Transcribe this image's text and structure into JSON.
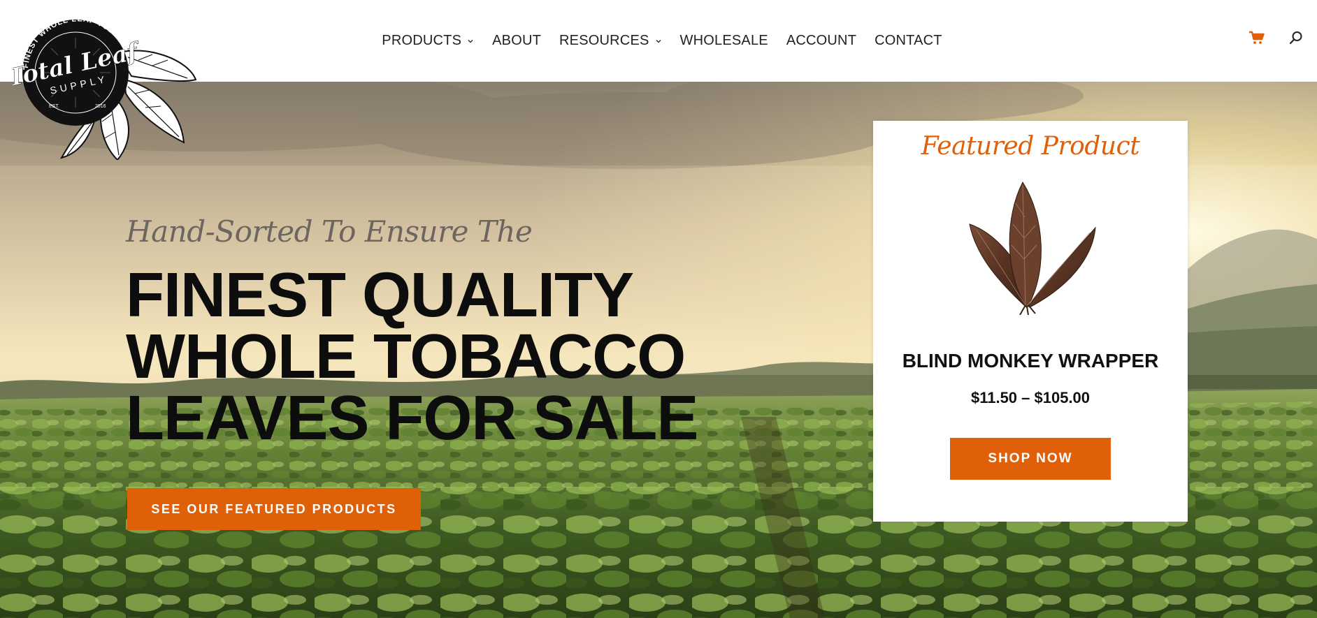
{
  "brand": {
    "logo_text": "Total Leaf",
    "logo_sub": "SUPPLY",
    "logo_ring": "FINEST WHOLE LEAF TOBACCO",
    "logo_est": "EST.",
    "logo_year": "2016"
  },
  "nav": {
    "items": [
      {
        "label": "PRODUCTS",
        "has_dropdown": true
      },
      {
        "label": "ABOUT",
        "has_dropdown": false
      },
      {
        "label": "RESOURCES",
        "has_dropdown": true
      },
      {
        "label": "WHOLESALE",
        "has_dropdown": false
      },
      {
        "label": "ACCOUNT",
        "has_dropdown": false
      },
      {
        "label": "CONTACT",
        "has_dropdown": false
      }
    ],
    "icons": [
      "cart-icon",
      "search-icon"
    ]
  },
  "hero": {
    "tagline": "Hand-Sorted To Ensure The",
    "headline_lines": [
      "FINEST QUALITY",
      "WHOLE TOBACCO",
      "LEAVES FOR SALE"
    ],
    "cta_label": "SEE OUR FEATURED PRODUCTS"
  },
  "featured": {
    "title": "Featured Product",
    "product_name": "BLIND MONKEY WRAPPER",
    "price": "$11.50 – $105.00",
    "button_label": "SHOP NOW"
  },
  "colors": {
    "accent": "#e0600a",
    "text_dark": "#0d0d0d",
    "nav_text": "#222222"
  }
}
